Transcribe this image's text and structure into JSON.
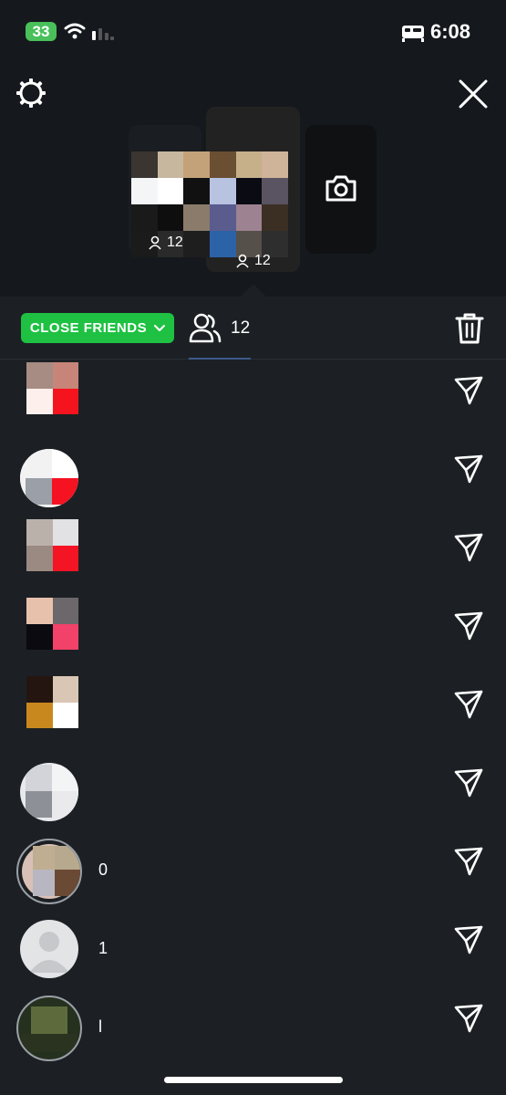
{
  "status": {
    "battery": "33",
    "time": "6:08",
    "icons": [
      "battery-icon",
      "wifi-icon",
      "signal-icon",
      "sleep-focus-icon"
    ]
  },
  "header": {
    "settings_icon": "gear-icon",
    "close_icon": "close-icon"
  },
  "carousel": {
    "left_count": "12",
    "center_count": "12",
    "camera_icon": "camera-icon"
  },
  "toolbar": {
    "audience_label": "CLOSE FRIENDS",
    "viewer_count": "12",
    "delete_icon": "trash-icon",
    "accent": "#1fc143"
  },
  "recipients": [
    {
      "label": "",
      "send_icon": "send-icon"
    },
    {
      "label": "",
      "send_icon": "send-icon"
    },
    {
      "label": "",
      "send_icon": "send-icon"
    },
    {
      "label": "",
      "send_icon": "send-icon"
    },
    {
      "label": "",
      "send_icon": "send-icon"
    },
    {
      "label": "",
      "send_icon": "send-icon"
    },
    {
      "label": "0",
      "send_icon": "send-icon"
    },
    {
      "label": "1",
      "send_icon": "send-icon"
    },
    {
      "label": "l",
      "send_icon": "send-icon"
    }
  ]
}
